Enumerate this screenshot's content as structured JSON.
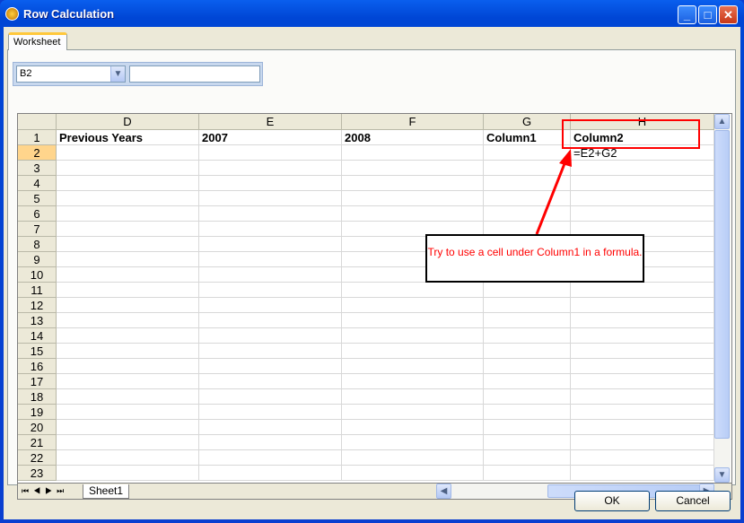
{
  "window": {
    "title": "Row Calculation",
    "minimize": "_",
    "maximize": "□",
    "close": "✕"
  },
  "tab": "Worksheet",
  "namebox": "B2",
  "formula": "",
  "columns": [
    "D",
    "E",
    "F",
    "G",
    "H"
  ],
  "rows": [
    "1",
    "2",
    "3",
    "4",
    "5",
    "6",
    "7",
    "8",
    "9",
    "10",
    "11",
    "12",
    "13",
    "14",
    "15",
    "16",
    "17",
    "18",
    "19",
    "20",
    "21",
    "22",
    "23"
  ],
  "selected_row": "2",
  "cells": {
    "r1": [
      "Previous Years",
      "2007",
      "2008",
      "Column1",
      "Column2"
    ],
    "r2": [
      "",
      "",
      "",
      "",
      "=E2+G2"
    ]
  },
  "sheet_tab": "Sheet1",
  "nav": "⏮◀▶⏭",
  "annotation": {
    "text": "Try to use a cell under Column1 in a formula.",
    "color": "#ff0000"
  },
  "buttons": {
    "ok": "OK",
    "cancel": "Cancel"
  }
}
